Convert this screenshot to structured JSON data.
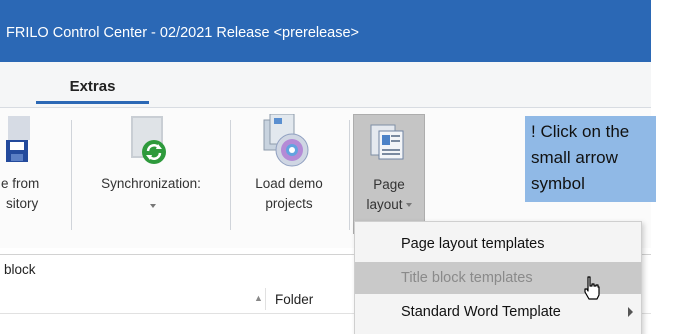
{
  "window": {
    "title": "FRILO Control Center - 02/2021  Release <prerelease>"
  },
  "tabs": {
    "extras": "Extras"
  },
  "ribbon": {
    "save_to_repository": {
      "line1": "e from",
      "line2": "sitory"
    },
    "synchronization": {
      "line1": "Synchronization:"
    },
    "load_demo_projects": {
      "line1": "Load demo",
      "line2": "projects"
    },
    "page_layout": {
      "line1": "Page",
      "line2": "layout"
    }
  },
  "searchbar": {
    "text": "block"
  },
  "table": {
    "folder_header": "Folder"
  },
  "tooltip": {
    "line1": "! Click on the",
    "line2": "small arrow",
    "line3": "symbol"
  },
  "menu": {
    "items": [
      {
        "label": "Page layout templates"
      },
      {
        "label": "Title block templates"
      },
      {
        "label": "Standard Word Template"
      }
    ]
  },
  "colors": {
    "accent": "#2b68b5",
    "tooltip_bg": "#90b9e6",
    "menu_highlight": "#c9c9c9"
  }
}
